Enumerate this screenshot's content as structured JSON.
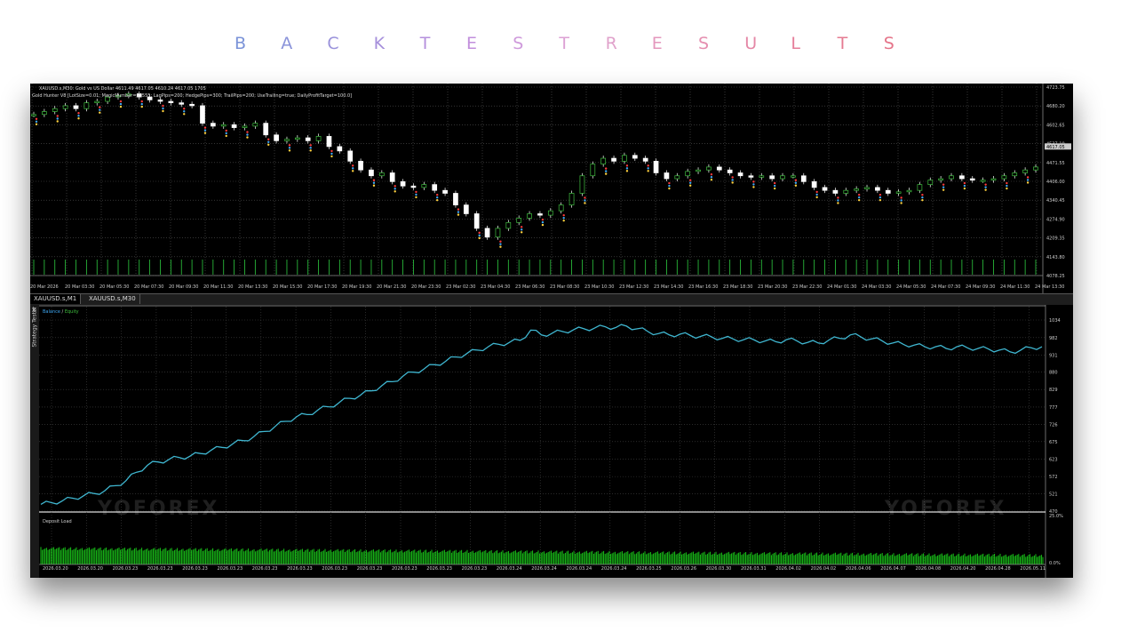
{
  "page_title": "B A C K T E S T R E S U L T S",
  "title_letters": [
    {
      "ch": "B",
      "color": "#7b93d8"
    },
    {
      "ch": "A",
      "color": "#8a93da"
    },
    {
      "ch": "C",
      "color": "#9a92db"
    },
    {
      "ch": "K",
      "color": "#a58fdb"
    },
    {
      "ch": "T",
      "color": "#b590dc"
    },
    {
      "ch": "E",
      "color": "#c28fdc"
    },
    {
      "ch": "S",
      "color": "#cf9bdc"
    },
    {
      "ch": "T",
      "color": "#dca1d4"
    },
    {
      "ch": "R",
      "color": "#e0a2cb"
    },
    {
      "ch": "E",
      "color": "#e497bd"
    },
    {
      "ch": "S",
      "color": "#e58fb0"
    },
    {
      "ch": "U",
      "color": "#e487a6"
    },
    {
      "ch": "L",
      "color": "#e57e9a"
    },
    {
      "ch": "T",
      "color": "#e57b92"
    },
    {
      "ch": "S",
      "color": "#e5758a"
    }
  ],
  "chart_header": {
    "symbol_line": "XAUUSD.s,M30:  Gold vs US Dollar  4611.49 4617.05 4610.24 4617.05  1705",
    "ea_line": "Gold Hunter V8 [LotSize=0.01; MagicNumber=55555; LagPips=200; HedgePips=300; TrailPips=200; UseTrailing=true; DailyProfitTarget=100.0]"
  },
  "price_axis": [
    "4723.75",
    "4680.20",
    "4602.65",
    "4537.10",
    "4471.55",
    "4406.00",
    "4340.45",
    "4274.90",
    "4209.35",
    "4143.80",
    "4078.25"
  ],
  "current_price": "4617.05",
  "time_axis": [
    "20 Mar 2026",
    "20 Mar 03:30",
    "20 Mar 05:30",
    "20 Mar 07:30",
    "20 Mar 09:30",
    "20 Mar 11:30",
    "20 Mar 13:30",
    "20 Mar 15:30",
    "20 Mar 17:30",
    "20 Mar 19:30",
    "20 Mar 21:30",
    "20 Mar 23:30",
    "23 Mar 02:30",
    "23 Mar 04:30",
    "23 Mar 06:30",
    "23 Mar 08:30",
    "23 Mar 10:30",
    "23 Mar 12:30",
    "23 Mar 14:30",
    "23 Mar 16:30",
    "23 Mar 18:30",
    "23 Mar 20:30",
    "23 Mar 22:30",
    "24 Mar 01:30",
    "24 Mar 03:30",
    "24 Mar 05:30",
    "24 Mar 07:30",
    "24 Mar 09:30",
    "24 Mar 11:30",
    "24 Mar 13:30"
  ],
  "tabs": [
    {
      "label": "XAUUSD.s,M1",
      "active": true
    },
    {
      "label": "XAUUSD.s,M30",
      "active": false
    }
  ],
  "tester": {
    "sidebar_label": "Strategy Tester",
    "close_label": "×",
    "legend_balance": "Balance",
    "legend_sep": " / ",
    "legend_equity": "Equity",
    "balance_axis": [
      "1034",
      "982",
      "931",
      "880",
      "829",
      "777",
      "726",
      "675",
      "623",
      "572",
      "521",
      "470"
    ],
    "deposit_label": "Deposit Load",
    "deposit_axis": [
      "25.0%",
      "0.0%"
    ],
    "date_axis": [
      "2026.03.20",
      "2026.03.20",
      "2026.03.23",
      "2026.03.23",
      "2026.03.23",
      "2026.03.23",
      "2026.03.23",
      "2026.03.23",
      "2026.03.23",
      "2026.03.23",
      "2026.03.23",
      "2026.03.23",
      "2026.03.23",
      "2026.03.24",
      "2026.03.24",
      "2026.03.24",
      "2026.03.24",
      "2026.03.25",
      "2026.03.26",
      "2026.03.30",
      "2026.03.31",
      "2026.04.02",
      "2026.04.02",
      "2026.04.06",
      "2026.04.07",
      "2026.04.08",
      "2026.04.20",
      "2026.04.28",
      "2026.05.11"
    ]
  },
  "watermark": "YOFOREX",
  "chart_data": [
    {
      "type": "line",
      "title": "",
      "series": [
        {
          "name": "Balance",
          "values": [
            490,
            495,
            500,
            508,
            515,
            522,
            530,
            545,
            560,
            585,
            605,
            615,
            622,
            628,
            632,
            640,
            650,
            658,
            668,
            678,
            690,
            705,
            720,
            735,
            748,
            755,
            768,
            778,
            790,
            803,
            812,
            825,
            840,
            852,
            868,
            880,
            890,
            902,
            912,
            925,
            935,
            945,
            955,
            962,
            968,
            974,
            1004,
            990,
            995,
            1000,
            1005,
            1008,
            1010,
            1014,
            1012,
            1016,
            1008,
            1000,
            994,
            990,
            992,
            988,
            986,
            984,
            980,
            978,
            976,
            975,
            972,
            970,
            976,
            972,
            968,
            966,
            975,
            980,
            990,
            984,
            978,
            972,
            966,
            962,
            960,
            955,
            955,
            950,
            955,
            952,
            950,
            948,
            945,
            940,
            945,
            952,
            955
          ]
        }
      ],
      "ylim": [
        470,
        1034
      ]
    },
    {
      "type": "line",
      "title": "",
      "series": [
        {
          "name": "",
          "values": [
            4630,
            4640,
            4650,
            4660,
            4650,
            4670,
            4675,
            4690,
            4695,
            4700,
            4690,
            4680,
            4675,
            4670,
            4665,
            4660,
            4600,
            4590,
            4595,
            4585,
            4590,
            4600,
            4560,
            4540,
            4545,
            4550,
            4540,
            4555,
            4520,
            4505,
            4470,
            4440,
            4420,
            4430,
            4400,
            4385,
            4380,
            4390,
            4370,
            4360,
            4320,
            4290,
            4240,
            4210,
            4240,
            4260,
            4275,
            4290,
            4285,
            4300,
            4320,
            4360,
            4420,
            4460,
            4480,
            4470,
            4490,
            4480,
            4470,
            4430,
            4410,
            4420,
            4435,
            4440,
            4450,
            4440,
            4430,
            4420,
            4415,
            4420,
            4410,
            4420,
            4420,
            4400,
            4380,
            4370,
            4360,
            4370,
            4375,
            4380,
            4370,
            4360,
            4365,
            4370,
            4390,
            4405,
            4410,
            4420,
            4410,
            4405,
            4405,
            4410,
            4420,
            4430,
            4440,
            4450
          ]
        }
      ],
      "ylim": [
        4078.25,
        4723.75
      ]
    }
  ]
}
